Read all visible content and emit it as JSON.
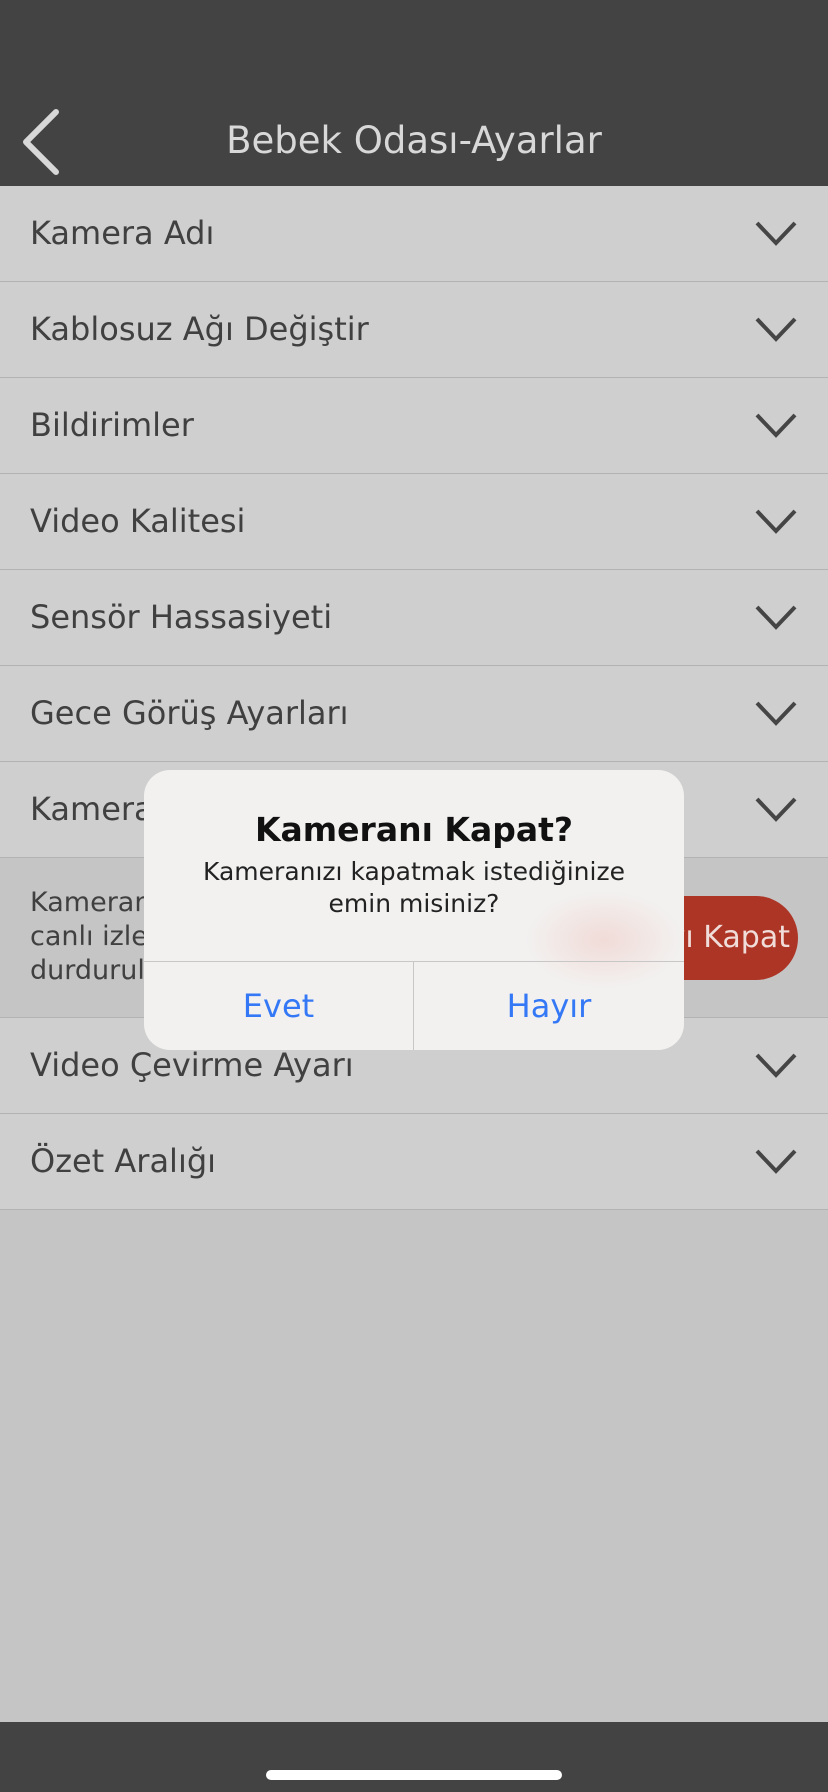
{
  "header": {
    "title": "Bebek Odası-Ayarlar"
  },
  "rows_top": [
    {
      "label": "Kamera Adı"
    },
    {
      "label": "Kablosuz Ağı Değiştir"
    },
    {
      "label": "Bildirimler"
    },
    {
      "label": "Video Kalitesi"
    },
    {
      "label": "Sensör Hassasiyeti"
    },
    {
      "label": "Gece Görüş Ayarları"
    },
    {
      "label": "Kamera"
    }
  ],
  "camera_section": {
    "description": "Kameran\ncanlı izle\ndurdurul",
    "turn_off_button": "yı Kapat"
  },
  "rows_bottom": [
    {
      "label": "Video Çevirme Ayarı"
    },
    {
      "label": "Özet Aralığı"
    }
  ],
  "dialog": {
    "title": "Kameranı Kapat?",
    "message": "Kameranızı kapatmak istediğinize emin misiniz?",
    "yes": "Evet",
    "no": "Hayır"
  },
  "colors": {
    "header_bg": "#434343",
    "accent_red": "#ad3526",
    "dialog_button": "#3478f6"
  }
}
